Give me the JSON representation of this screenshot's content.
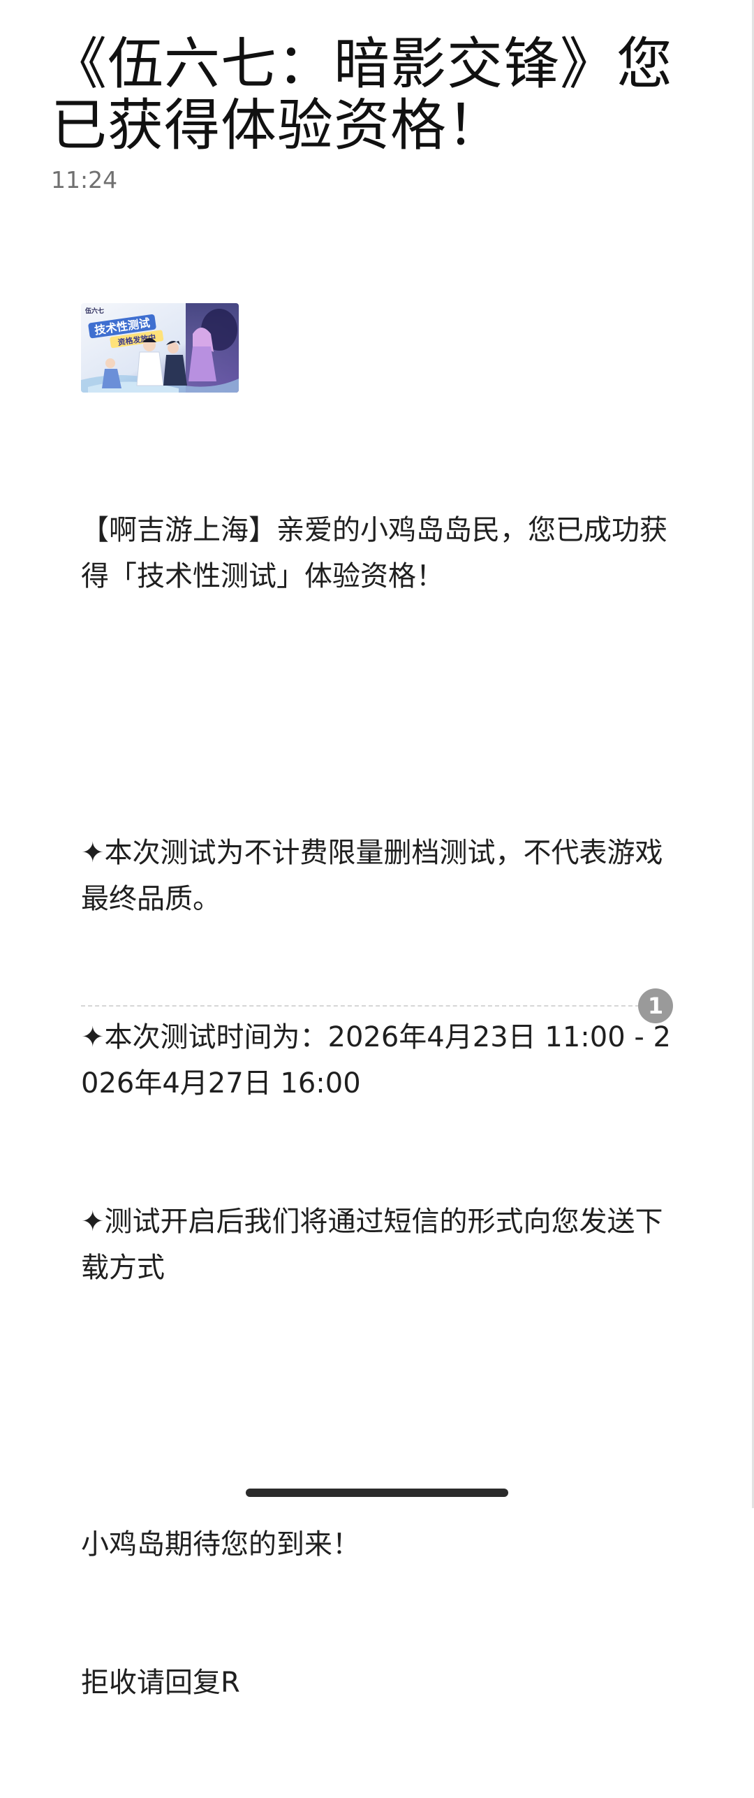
{
  "message": {
    "title": "《伍六七：暗影交锋》您已获得体验资格！",
    "time": "11:24",
    "banner": {
      "icon_name": "game-promo-banner",
      "logo_text": "伍六七",
      "headline": "技术性测试",
      "subline": "资格发放中"
    },
    "paragraphs": {
      "intro": "【啊吉游上海】亲爱的小鸡岛岛民，您已成功获得「技术性测试」体验资格！",
      "bullet1": "✦本次测试为不计费限量删档测试，不代表游戏最终品质。",
      "bullet2": "✦本次测试时间为：2026年4月23日 11:00 - 2026年4月27日 16:00",
      "bullet3": "✦测试开启后我们将通过短信的形式向您发送下载方式",
      "closing": "小鸡岛期待您的到来！",
      "unsubscribe": "拒收请回复R"
    },
    "count_badge": "1"
  },
  "colors": {
    "title": "#111111",
    "time": "#707070",
    "badge_bg": "#9a9a9a",
    "home_indicator": "#2b2b2b"
  }
}
